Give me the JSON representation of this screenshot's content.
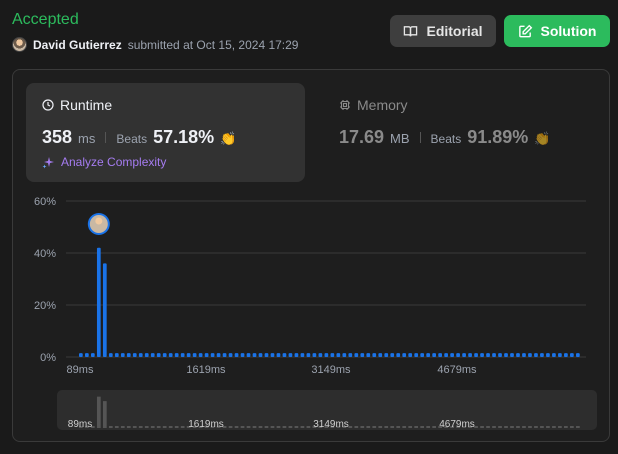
{
  "header": {
    "status": "Accepted",
    "user_name": "David Gutierrez",
    "submitted_text": "submitted at Oct 15, 2024 17:29",
    "editorial_label": "Editorial",
    "solution_label": "Solution"
  },
  "runtime": {
    "title": "Runtime",
    "value": "358",
    "unit": "ms",
    "beats_label": "Beats",
    "beats_pct": "57.18%",
    "analyze_label": "Analyze Complexity"
  },
  "memory": {
    "title": "Memory",
    "value": "17.69",
    "unit": "MB",
    "beats_label": "Beats",
    "beats_pct": "91.89%"
  },
  "colors": {
    "accepted": "#2cbb5d",
    "bar": "#1a73e8",
    "bar_mini": "#555555",
    "analyze": "#a57cf0"
  },
  "chart_data": {
    "type": "bar",
    "y_ticks": [
      "60%",
      "40%",
      "20%",
      "0%"
    ],
    "ylim": [
      0,
      60
    ],
    "x_ticks": [
      "89ms",
      "1619ms",
      "3149ms",
      "4679ms"
    ],
    "mini_x_ticks": [
      "89ms",
      "1619ms",
      "3149ms",
      "4679ms"
    ],
    "bin_count": 84,
    "user_bin": 3,
    "values": [
      1.5,
      1.5,
      1.5,
      42,
      36,
      1.5,
      1.5,
      1.5,
      1.5,
      1.5,
      1.5,
      1.5,
      1.5,
      1.5,
      1.5,
      1.5,
      1.5,
      1.5,
      1.5,
      1.5,
      1.5,
      1.5,
      1.5,
      1.5,
      1.5,
      1.5,
      1.5,
      1.5,
      1.5,
      1.5,
      1.5,
      1.5,
      1.5,
      1.5,
      1.5,
      1.5,
      1.5,
      1.5,
      1.5,
      1.5,
      1.5,
      1.5,
      1.5,
      1.5,
      1.5,
      1.5,
      1.5,
      1.5,
      1.5,
      1.5,
      1.5,
      1.5,
      1.5,
      1.5,
      1.5,
      1.5,
      1.5,
      1.5,
      1.5,
      1.5,
      1.5,
      1.5,
      1.5,
      1.5,
      1.5,
      1.5,
      1.5,
      1.5,
      1.5,
      1.5,
      1.5,
      1.5,
      1.5,
      1.5,
      1.5,
      1.5,
      1.5,
      1.5,
      1.5,
      1.5,
      1.5,
      1.5,
      1.5,
      1.5
    ],
    "grid": true
  }
}
